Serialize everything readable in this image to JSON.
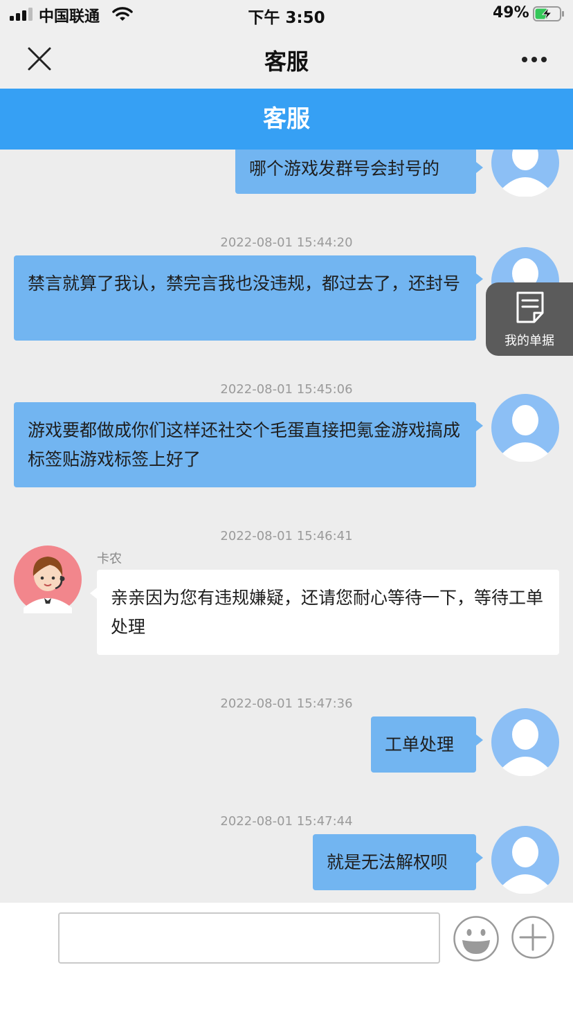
{
  "status_bar": {
    "carrier": "中国联通",
    "time": "下午 3:50",
    "battery": "49%"
  },
  "nav": {
    "title": "客服"
  },
  "header": {
    "title": "客服"
  },
  "floating_tab": {
    "label": "我的单据"
  },
  "messages": [
    {
      "from": "user",
      "text": "哪个游戏发群号会封号的"
    },
    {
      "from": "user",
      "timestamp": "2022-08-01 15:44:20",
      "text": "禁言就算了我认，禁完言我也没违规，都过去了，还封号"
    },
    {
      "from": "user",
      "timestamp": "2022-08-01 15:45:06",
      "text": "游戏要都做成你们这样还社交个毛蛋直接把氪金游戏搞成标签贴游戏标签上好了"
    },
    {
      "from": "agent",
      "timestamp": "2022-08-01 15:46:41",
      "sender_name": "卡农",
      "text": "亲亲因为您有违规嫌疑，还请您耐心等待一下，等待工单处理"
    },
    {
      "from": "user",
      "timestamp": "2022-08-01 15:47:36",
      "text": "工单处理"
    },
    {
      "from": "user",
      "timestamp": "2022-08-01 15:47:44",
      "text": "就是无法解权呗"
    }
  ],
  "input": {
    "value": "",
    "placeholder": ""
  },
  "colors": {
    "header_blue": "#36a0f4",
    "user_bubble": "#72b5f1",
    "agent_bubble": "#ffffff",
    "chat_background": "#ededed"
  }
}
